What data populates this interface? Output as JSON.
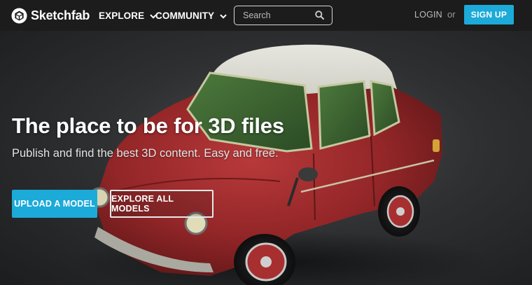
{
  "brand": {
    "name": "Sketchfab"
  },
  "nav": {
    "explore_label": "EXPLORE",
    "community_label": "COMMUNITY",
    "search_placeholder": "Search",
    "login_label": "LOGIN",
    "or_text": "or",
    "signup_label": "SIGN UP"
  },
  "hero": {
    "title": "The place to be for 3D files",
    "subtitle": "Publish and find the best 3D content. Easy and free.",
    "upload_label": "UPLOAD A MODEL",
    "explore_label": "EXPLORE ALL MODELS"
  },
  "colors": {
    "accent": "#1caad9",
    "navbar_bg": "#1c1c1c",
    "hero_bg": "#2f3032",
    "car_red": "#9e2b2d",
    "car_roof": "#d9d9cf",
    "window_green": "#3f6a33"
  },
  "icons": {
    "logo": "sketchfab-logo-icon",
    "explore_chevron": "chevron-down-icon",
    "community_chevron": "chevron-down-icon",
    "search": "search-icon"
  }
}
